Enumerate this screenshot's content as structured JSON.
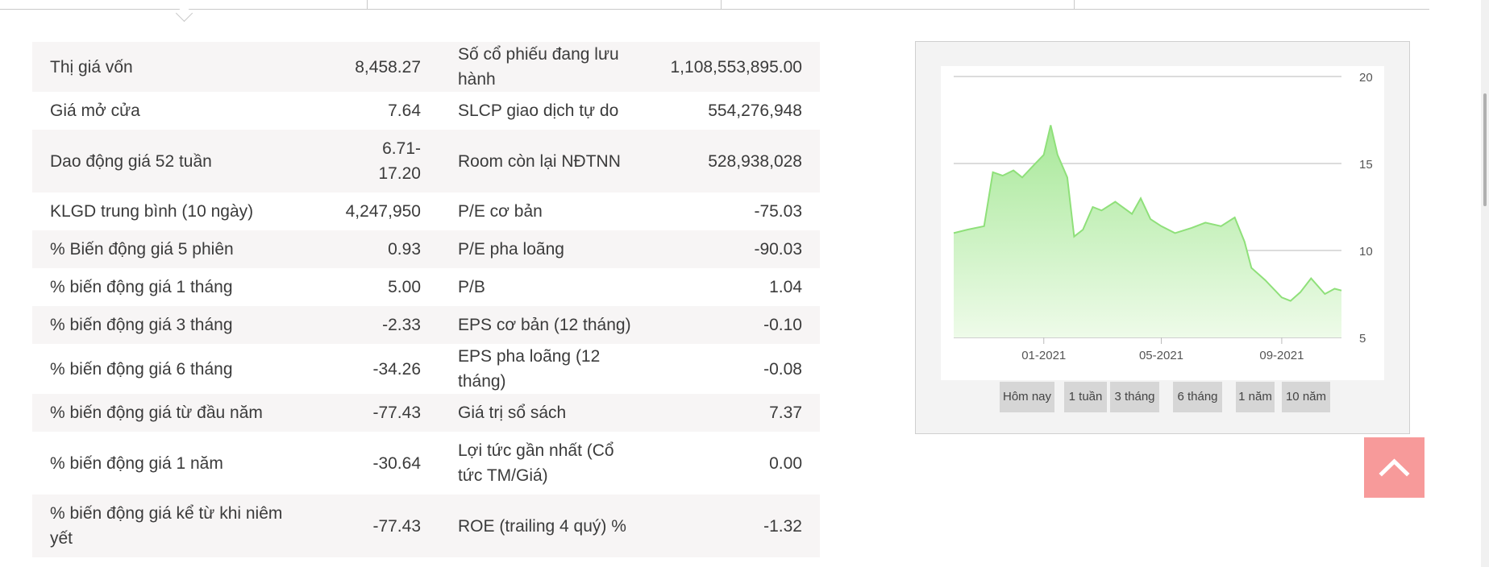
{
  "stats": {
    "rows": [
      {
        "l1": "Thị giá vốn",
        "v1": "8,458.27",
        "l2": "Số cổ phiếu đang lưu hành",
        "v2": "1,108,553,895.00"
      },
      {
        "l1": "Giá mở cửa",
        "v1": "7.64",
        "l2": "SLCP giao dịch tự do",
        "v2": "554,276,948"
      },
      {
        "l1": "Dao động giá 52 tuần",
        "v1": "6.71-\n17.20",
        "l2": "Room còn lại NĐTNN",
        "v2": "528,938,028"
      },
      {
        "l1": "KLGD trung bình (10 ngày)",
        "v1": "4,247,950",
        "l2": "P/E cơ bản",
        "v2": "-75.03"
      },
      {
        "l1": "% Biến động giá 5 phiên",
        "v1": "0.93",
        "l2": "P/E pha loãng",
        "v2": "-90.03"
      },
      {
        "l1": "% biến động giá 1 tháng",
        "v1": "5.00",
        "l2": "P/B",
        "v2": "1.04"
      },
      {
        "l1": "% biến động giá 3 tháng",
        "v1": "-2.33",
        "l2": "EPS cơ bản (12 tháng)",
        "v2": "-0.10"
      },
      {
        "l1": "% biến động giá 6 tháng",
        "v1": "-34.26",
        "l2": "EPS pha loãng (12 tháng)",
        "v2": "-0.08"
      },
      {
        "l1": "% biến động giá từ đầu năm",
        "v1": "-77.43",
        "l2": "Giá trị sổ sách",
        "v2": "7.37"
      },
      {
        "l1": "% biến động giá 1 năm",
        "v1": "-30.64",
        "l2": "Lợi tức gần nhất (Cổ tức TM/Giá)",
        "v2": "0.00"
      },
      {
        "l1": "% biến động giá kể từ khi niêm yết",
        "v1": "-77.43",
        "l2": "ROE (trailing 4 quý) %",
        "v2": "-1.32"
      }
    ]
  },
  "chart": {
    "range_buttons": [
      "Hôm nay",
      "1 tuần",
      "3 tháng",
      "6 tháng",
      "1 năm",
      "10 năm"
    ],
    "colors": {
      "line": "#8fe07a",
      "fill_top": "#a7e898",
      "fill_bottom": "#eefbe9",
      "grid": "#d0d0d0"
    }
  },
  "chart_data": {
    "type": "area",
    "title": "",
    "xlabel": "",
    "ylabel": "",
    "ylim": [
      5,
      20
    ],
    "yticks": [
      5,
      10,
      15,
      20
    ],
    "xticks": [
      "01-2021",
      "05-2021",
      "09-2021"
    ],
    "grid": true,
    "x": [
      "2020-10-01",
      "2020-10-15",
      "2020-11-01",
      "2020-11-10",
      "2020-11-20",
      "2020-12-01",
      "2020-12-10",
      "2020-12-20",
      "2021-01-01",
      "2021-01-08",
      "2021-01-15",
      "2021-01-25",
      "2021-02-01",
      "2021-02-10",
      "2021-02-20",
      "2021-03-01",
      "2021-03-15",
      "2021-04-01",
      "2021-04-10",
      "2021-04-20",
      "2021-05-01",
      "2021-05-15",
      "2021-06-01",
      "2021-06-15",
      "2021-07-01",
      "2021-07-15",
      "2021-07-25",
      "2021-08-01",
      "2021-08-15",
      "2021-09-01",
      "2021-09-10",
      "2021-09-20",
      "2021-10-01",
      "2021-10-15",
      "2021-10-25",
      "2021-11-01"
    ],
    "values": [
      11.0,
      11.2,
      11.4,
      14.5,
      14.3,
      14.6,
      14.2,
      14.8,
      15.5,
      17.2,
      15.5,
      14.2,
      10.8,
      11.2,
      12.5,
      12.3,
      12.8,
      12.1,
      13.0,
      11.8,
      11.4,
      11.0,
      11.3,
      11.6,
      11.4,
      11.9,
      10.5,
      9.0,
      8.3,
      7.3,
      7.1,
      7.6,
      8.4,
      7.5,
      7.8,
      7.7
    ]
  }
}
